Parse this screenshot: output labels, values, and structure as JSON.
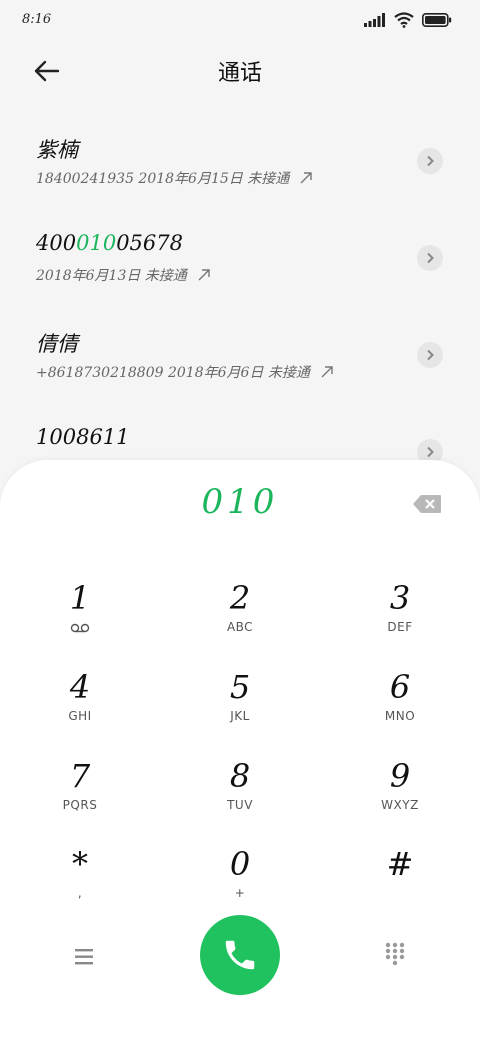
{
  "status_bar": {
    "time": "8:16"
  },
  "header": {
    "title": "通话"
  },
  "calls": [
    {
      "name_pre": "紫楠",
      "name_hl": "",
      "name_post": "",
      "detail": "18400241935 2018年6月15日 未接通"
    },
    {
      "name_pre": "400",
      "name_hl": "010",
      "name_post": "05678",
      "detail": "2018年6月13日 未接通"
    },
    {
      "name_pre": "倩倩",
      "name_hl": "",
      "name_post": "",
      "detail": "+8618730218809 2018年6月6日 未接通"
    },
    {
      "name_pre": "1008611",
      "name_hl": "",
      "name_post": "",
      "detail": ""
    }
  ],
  "dialer": {
    "number": "010",
    "keys": [
      {
        "digit": "1",
        "letters": ""
      },
      {
        "digit": "2",
        "letters": "ABC"
      },
      {
        "digit": "3",
        "letters": "DEF"
      },
      {
        "digit": "4",
        "letters": "GHI"
      },
      {
        "digit": "5",
        "letters": "JKL"
      },
      {
        "digit": "6",
        "letters": "MNO"
      },
      {
        "digit": "7",
        "letters": "PQRS"
      },
      {
        "digit": "8",
        "letters": "TUV"
      },
      {
        "digit": "9",
        "letters": "WXYZ"
      },
      {
        "digit": "*",
        "letters": ","
      },
      {
        "digit": "0",
        "letters": "+"
      },
      {
        "digit": "#",
        "letters": ""
      }
    ]
  },
  "icons": {
    "back": "back-arrow-icon",
    "detail": "chevron-right-icon",
    "voicemail": "voicemail-icon",
    "backspace": "backspace-icon",
    "menu": "menu-icon",
    "call": "phone-icon",
    "keypad": "keypad-icon"
  },
  "colors": {
    "accent": "#1bb55c",
    "call_button": "#1fc25e"
  }
}
